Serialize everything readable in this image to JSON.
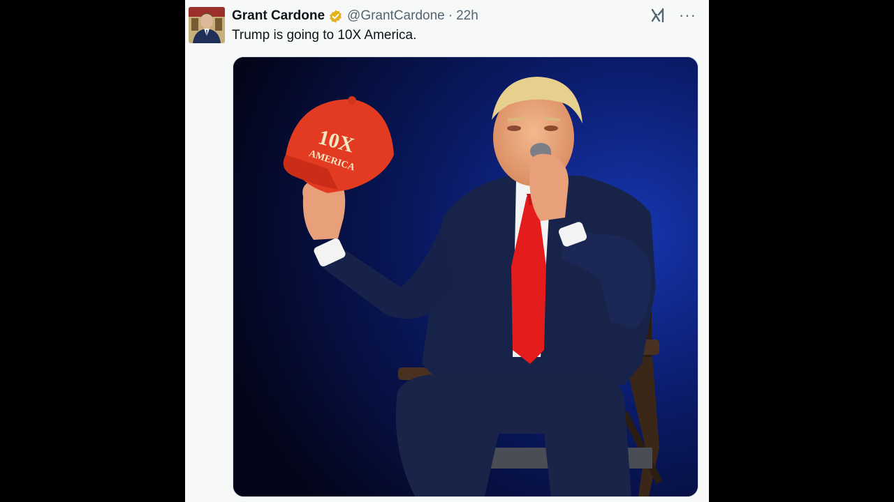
{
  "tweet": {
    "author_name": "Grant Cardone",
    "handle": "@GrantCardone",
    "separator": "·",
    "time": "22h",
    "text": "Trump is going to 10X America.",
    "verified_badge_color": "#e6b21a",
    "more_label": "···"
  },
  "media": {
    "hat_text_line1": "10X",
    "hat_text_line2": "AMERICA",
    "hat_color": "#e23b21",
    "tie_color": "#e41c1c",
    "suit_color": "#182349"
  },
  "icons": {
    "verified": "verified-badge-icon",
    "grok": "grok-icon",
    "more": "more-options-icon"
  }
}
